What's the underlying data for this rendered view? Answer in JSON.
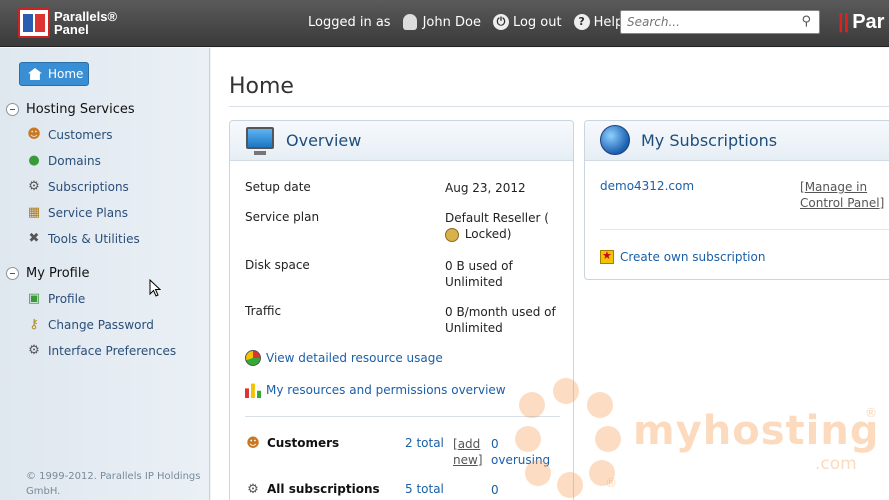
{
  "header": {
    "logo_line1": "Parallels®",
    "logo_line2": "Panel",
    "logged_in_as": "Logged in as",
    "user_name": "John Doe",
    "logout": "Log out",
    "help": "Help",
    "search_placeholder": "Search...",
    "brand_right": "Par"
  },
  "sidebar": {
    "home": "Home",
    "sections": [
      {
        "title": "Hosting Services",
        "items": [
          {
            "label": "Customers",
            "icon": "customers-icon"
          },
          {
            "label": "Domains",
            "icon": "domains-icon"
          },
          {
            "label": "Subscriptions",
            "icon": "subscriptions-icon"
          },
          {
            "label": "Service Plans",
            "icon": "service-plans-icon"
          },
          {
            "label": "Tools & Utilities",
            "icon": "tools-icon"
          }
        ]
      },
      {
        "title": "My Profile",
        "items": [
          {
            "label": "Profile",
            "icon": "profile-icon"
          },
          {
            "label": "Change Password",
            "icon": "key-icon"
          },
          {
            "label": "Interface Preferences",
            "icon": "preferences-icon"
          }
        ]
      }
    ],
    "copyright": "© 1999-2012. Parallels IP Holdings GmbH."
  },
  "main": {
    "title": "Home",
    "overview": {
      "title": "Overview",
      "rows": [
        {
          "label": "Setup date",
          "value": "Aug 23, 2012"
        },
        {
          "label": "Service plan",
          "value": "Default Reseller (",
          "value2": "Locked)"
        },
        {
          "label": "Disk space",
          "value": "0 B used of Unlimited"
        },
        {
          "label": "Traffic",
          "value": "0 B/month used of Unlimited"
        }
      ],
      "links": [
        {
          "label": "View detailed resource usage"
        },
        {
          "label": "My resources and permissions overview"
        }
      ],
      "stats": [
        {
          "label": "Customers",
          "total": "2 total",
          "add_open": "[",
          "add": "add",
          "add_new": "new",
          "add_close": "]",
          "count": "0",
          "count_label": "overusing"
        },
        {
          "label": "All subscriptions",
          "total": "5 total",
          "count": "0"
        }
      ]
    },
    "subscriptions": {
      "title": "My Subscriptions",
      "domain": "demo4312.com",
      "manage_open": "[",
      "manage_line1": "Manage in",
      "manage_line2": "Control Panel",
      "manage_close": "]",
      "create": "Create own subscription"
    }
  },
  "watermark": {
    "text": "myhosting",
    "sub": ".com",
    "reg": "®"
  },
  "colors": {
    "link": "#1a5fa8",
    "topbar": "#444444",
    "accent": "#3a8fd4",
    "watermark": "#f79646"
  }
}
